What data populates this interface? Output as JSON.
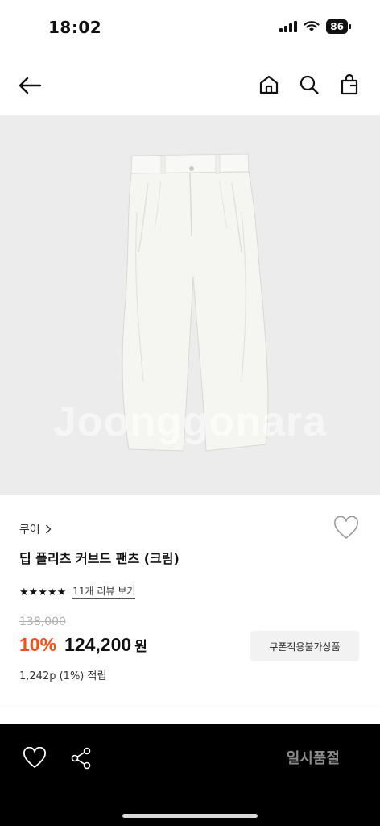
{
  "status": {
    "time": "18:02",
    "battery": "86"
  },
  "nav": {
    "icons": [
      "back-arrow-icon",
      "home-icon",
      "search-icon",
      "cart-icon"
    ]
  },
  "hero": {
    "watermark": "Joonggonara",
    "bg_color": "#ececec"
  },
  "product": {
    "brand": "쿠어",
    "name": "딥 플리츠 커브드 팬츠 (크림)",
    "stars": "★★★★★",
    "review_link": "11개 리뷰 보기",
    "original_price": "138,000",
    "discount": "10%",
    "price": "124,200",
    "currency": "원",
    "coupon_label": "쿠폰적용불가상품",
    "points": "1,242p (1%) 적립"
  },
  "bottom": {
    "soldout_label": "일시품절",
    "icons": [
      "heart-icon",
      "share-icon"
    ]
  },
  "colors": {
    "accent": "#ff4a10",
    "bar": "#000000"
  }
}
